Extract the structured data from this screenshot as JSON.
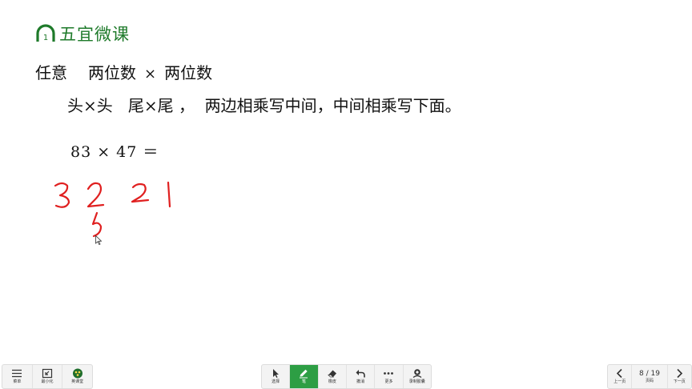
{
  "brand": {
    "logo_digit": "1",
    "name": "五宜微课",
    "color": "#1e7a2a"
  },
  "content": {
    "topic_a": "任意",
    "topic_b": "两位数",
    "times": "×",
    "topic_c": "两位数",
    "rule": "头×头   尾×尾 ，  两边相乘写中间，中间相乘写下面。",
    "equation": "83 × 47 ＝"
  },
  "handwriting": {
    "color": "#e02020",
    "digits": [
      "3",
      "2",
      "2",
      "1",
      "5"
    ]
  },
  "toolbar": {
    "menu_label": "菜单",
    "minimize_label": "最小化",
    "app_label": "英课堂",
    "select_label": "选择",
    "pen_label": "笔",
    "eraser_label": "橡皮",
    "undo_label": "撤消",
    "more_label": "更多",
    "record_label": "录制胶囊",
    "prev_label": "上一页",
    "page_indicator": "8 / 19",
    "page_label": "页码",
    "next_label": "下一页",
    "active_color": "#2d9e44"
  }
}
